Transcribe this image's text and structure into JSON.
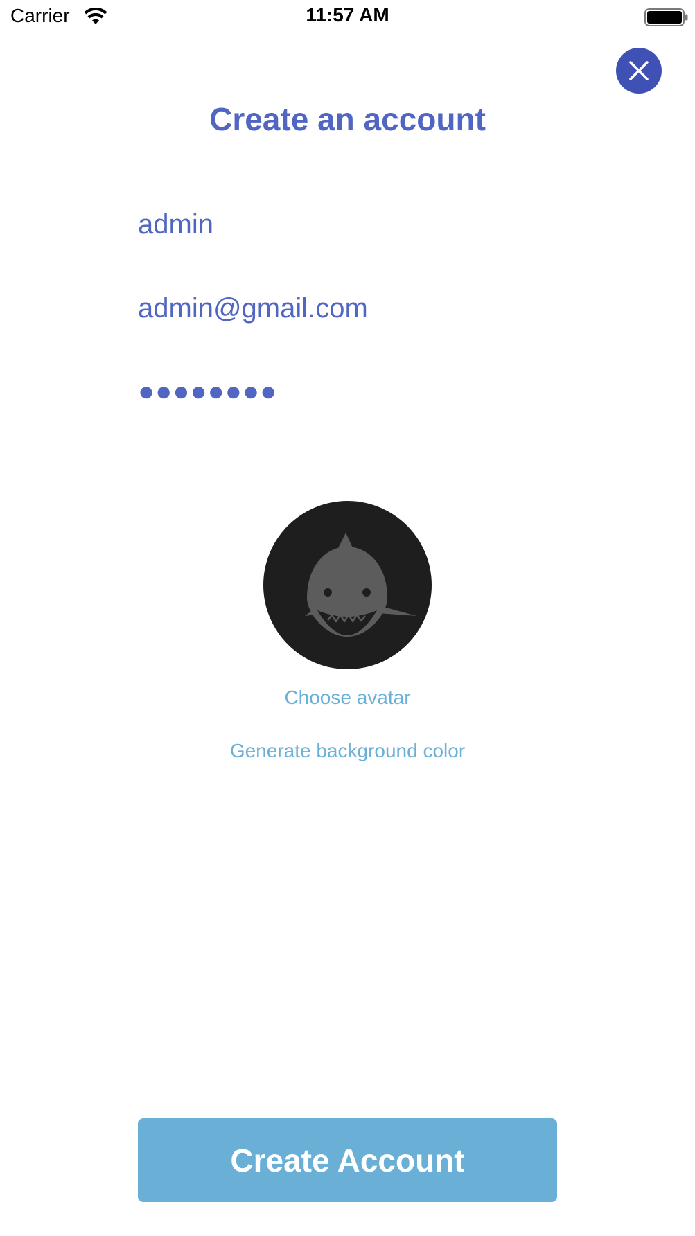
{
  "status_bar": {
    "carrier": "Carrier",
    "time": "11:57 AM"
  },
  "title": "Create an account",
  "form": {
    "username_value": "admin",
    "email_value": "admin@gmail.com",
    "password_masked": "●●●●●●●●"
  },
  "avatar": {
    "icon": "shark-icon",
    "background_color": "#1e1e1e"
  },
  "links": {
    "choose_avatar": "Choose avatar",
    "generate_background": "Generate background color"
  },
  "create_button_label": "Create Account",
  "colors": {
    "primary": "#3f51b5",
    "title_text": "#5066c2",
    "link": "#6bb0d6",
    "button": "#6aafd5"
  }
}
